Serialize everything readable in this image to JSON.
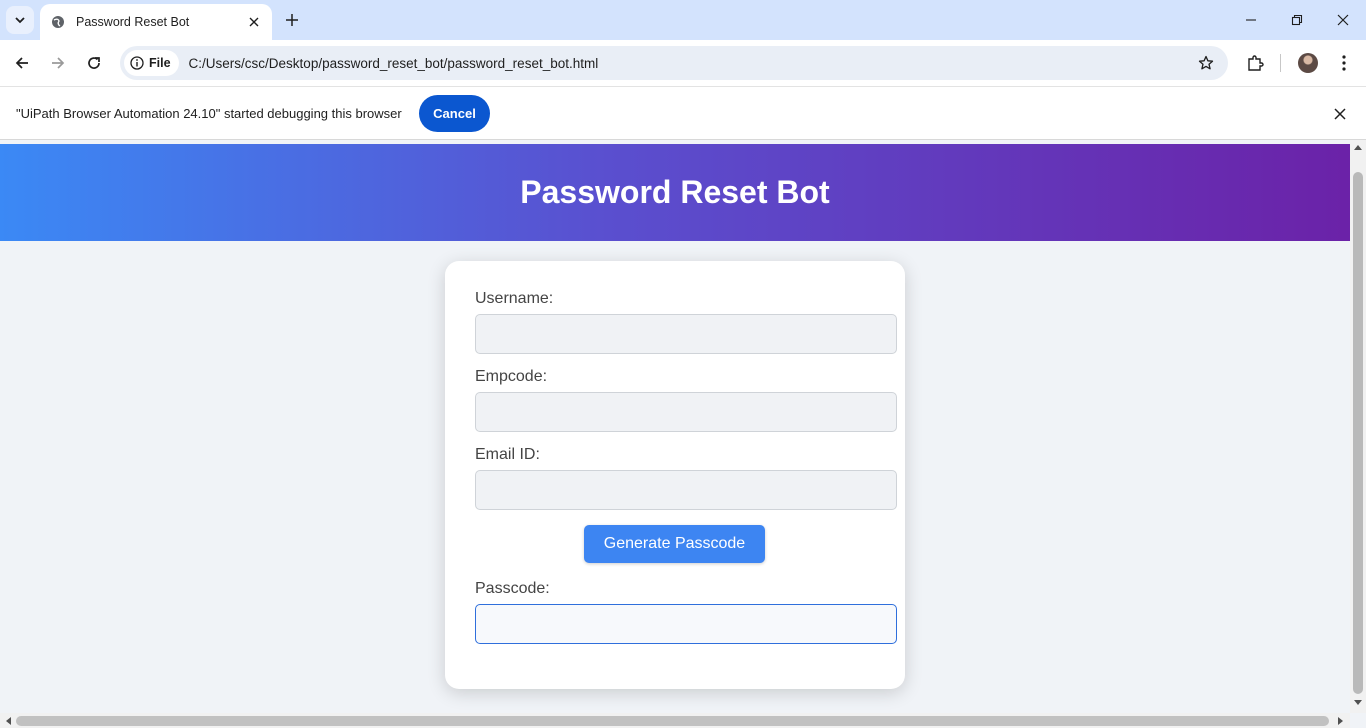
{
  "browser": {
    "tab_title": "Password Reset Bot",
    "chip_label": "File",
    "url": "C:/Users/csc/Desktop/password_reset_bot/password_reset_bot.html",
    "infobar_text": "\"UiPath Browser Automation 24.10\" started debugging this browser",
    "infobar_cancel": "Cancel",
    "icons": [
      "tab-search-icon",
      "globe-icon",
      "close-icon",
      "plus-icon",
      "minimize-icon",
      "restore-icon",
      "back-icon",
      "forward-icon",
      "reload-icon",
      "info-icon",
      "star-icon",
      "extensions-icon",
      "more-icon"
    ]
  },
  "page": {
    "header_title": "Password Reset Bot",
    "form": {
      "username_label": "Username:",
      "username_value": "",
      "empcode_label": "Empcode:",
      "empcode_value": "",
      "email_label": "Email ID:",
      "email_value": "",
      "generate_button": "Generate Passcode",
      "passcode_label": "Passcode:",
      "passcode_value": ""
    },
    "colors": {
      "header_gradient_start": "#3b89f5",
      "header_gradient_end": "#6b22a8",
      "button": "#3d85f2",
      "cancel_button": "#0b57d0"
    }
  }
}
